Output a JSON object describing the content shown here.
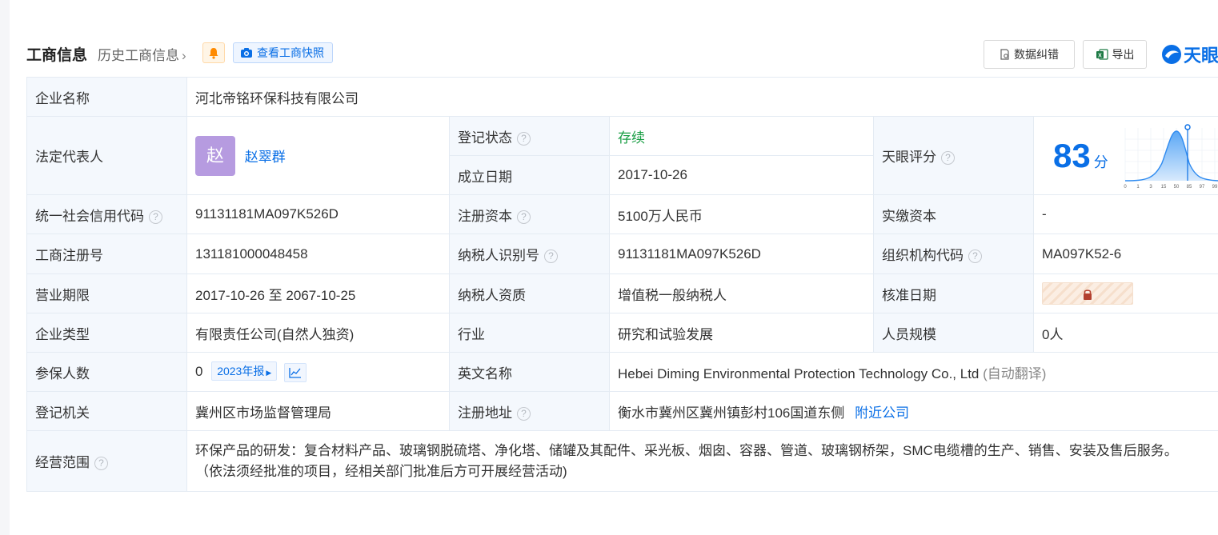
{
  "header": {
    "title": "工商信息",
    "history": "历史工商信息",
    "snapshot": "查看工商快照",
    "correct": "数据纠错",
    "export": "导出",
    "logo": "天眼"
  },
  "labels": {
    "name": "企业名称",
    "legal": "法定代表人",
    "reg_status": "登记状态",
    "found_date": "成立日期",
    "tianyan_score": "天眼评分",
    "credit_code": "统一社会信用代码",
    "reg_capital": "注册资本",
    "paid_capital": "实缴资本",
    "biz_reg_no": "工商注册号",
    "taxpayer_id": "纳税人识别号",
    "org_code": "组织机构代码",
    "term": "营业期限",
    "taxpayer_qual": "纳税人资质",
    "approve_date": "核准日期",
    "type": "企业类型",
    "industry": "行业",
    "staff": "人员规模",
    "insured": "参保人数",
    "english_name": "英文名称",
    "authority": "登记机关",
    "address": "注册地址",
    "scope": "经营范围"
  },
  "values": {
    "name": "河北帝铭环保科技有限公司",
    "legal_avatar": "赵",
    "legal_name": "赵翠群",
    "reg_status": "存续",
    "found_date": "2017-10-26",
    "score": "83",
    "score_unit": "分",
    "credit_code": "91131181MA097K526D",
    "reg_capital": "5100万人民币",
    "paid_capital": "-",
    "biz_reg_no": "131181000048458",
    "taxpayer_id": "91131181MA097K526D",
    "org_code": "MA097K52-6",
    "term": "2017-10-26 至 2067-10-25",
    "taxpayer_qual": "增值税一般纳税人",
    "type": "有限责任公司(自然人独资)",
    "industry": "研究和试验发展",
    "staff": "0人",
    "insured": "0",
    "insured_report": "2023年报",
    "english_name": "Hebei Diming Environmental Protection Technology Co., Ltd",
    "english_note": "(自动翻译)",
    "authority": "冀州区市场监督管理局",
    "address": "衡水市冀州区冀州镇彭村106国道东侧",
    "nearby": "附近公司",
    "scope_line1": "环保产品的研发：复合材料产品、玻璃钢脱硫塔、净化塔、储罐及其配件、采光板、烟囱、容器、管道、玻璃钢桥架，SMC电缆槽的生产、销售、安装及售后服务。",
    "scope_line2": "（依法须经批准的项目，经相关部门批准后方可开展经营活动)"
  },
  "score_chart": {
    "ticks": [
      "0",
      "1",
      "3",
      "15",
      "50",
      "85",
      "97",
      "99"
    ],
    "marker": 83
  },
  "colors": {
    "accent": "#0a6fe6",
    "status_green": "#1a9e45"
  }
}
